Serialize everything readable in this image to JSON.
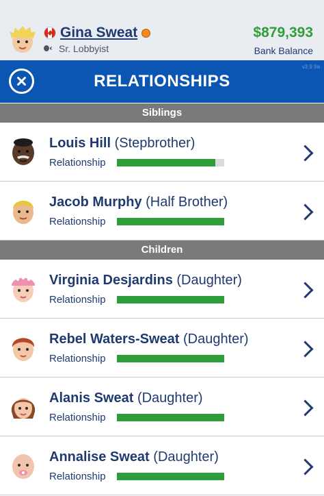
{
  "header": {
    "player_name": "Gina Sweat",
    "job_title": "Sr. Lobbyist",
    "bank_balance": "$879,393",
    "bank_balance_label": "Bank Balance"
  },
  "titlebar": {
    "title": "RELATIONSHIPS",
    "version": "v3.9.9a"
  },
  "sections": [
    {
      "title": "Siblings",
      "people": [
        {
          "name": "Louis Hill",
          "relation": "(Stepbrother)",
          "relationship_label": "Relationship",
          "relationship_level": 0.92,
          "avatar": "dark-skin-bald-mustache"
        },
        {
          "name": "Jacob Murphy",
          "relation": "(Half Brother)",
          "relationship_label": "Relationship",
          "relationship_level": 1.0,
          "avatar": "blonde-man"
        }
      ]
    },
    {
      "title": "Children",
      "people": [
        {
          "name": "Virginia Desjardins",
          "relation": "(Daughter)",
          "relationship_label": "Relationship",
          "relationship_level": 1.0,
          "avatar": "pink-hat-girl"
        },
        {
          "name": "Rebel Waters-Sweat",
          "relation": "(Daughter)",
          "relationship_label": "Relationship",
          "relationship_level": 1.0,
          "avatar": "red-hair-girl"
        },
        {
          "name": "Alanis Sweat",
          "relation": "(Daughter)",
          "relationship_label": "Relationship",
          "relationship_level": 1.0,
          "avatar": "brown-hair-girl"
        },
        {
          "name": "Annalise Sweat",
          "relation": "(Daughter)",
          "relationship_label": "Relationship",
          "relationship_level": 1.0,
          "avatar": "baby-pacifier"
        }
      ]
    }
  ],
  "colors": {
    "title_bar": "#0b56b3",
    "relationship_bar": "#2e9e3a",
    "balance": "#2f9e3a",
    "section_header": "#7a7a7a"
  }
}
